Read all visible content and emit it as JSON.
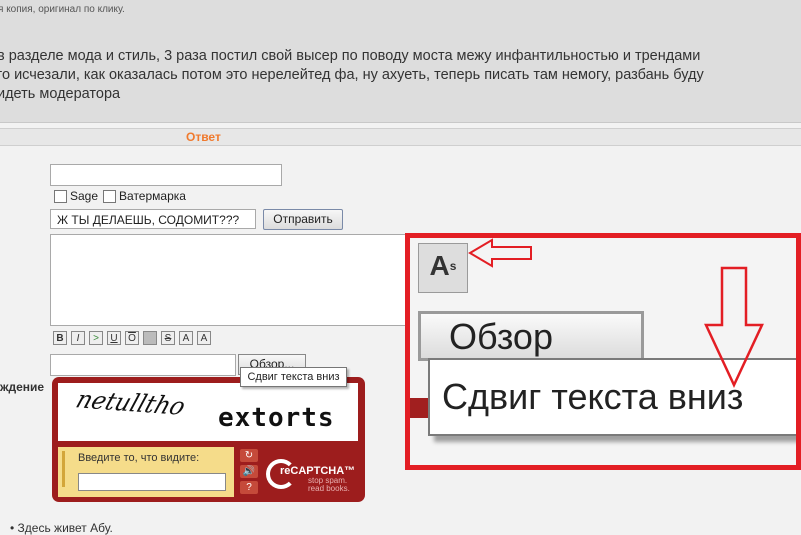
{
  "top_note": "я копия, оригинал по клику.",
  "post_lines": [
    "в разделе мода и стиль, 3 раза постил свой высер по поводу моста межу инфантильностью и трендами",
    "го исчезали, как оказалась потом это нерелейтед фа, ну ахуеть, теперь писать там немогу, разбань буду",
    "идеть модератора"
  ],
  "reply_header": "Ответ",
  "form": {
    "email_value": "",
    "sage_label": "Sage",
    "watermark_label": "Ватермарка",
    "subject_value": "Ж ТЫ ДЕЛАЕШЬ, СОДОМИТ???",
    "send_label": "Отправить",
    "message_value": "",
    "format_buttons": [
      "B",
      "I",
      ">",
      "U",
      "O",
      "",
      "S",
      "A",
      "A"
    ],
    "browse_label": "Обзор...",
    "tooltip": "Сдвиг текста вниз",
    "side_label": "ждение"
  },
  "captcha": {
    "word1": "netulltho",
    "word2": "extorts",
    "prompt": "Введите то, что видите:",
    "input_value": "",
    "controls": [
      "↻",
      "🔊",
      "?"
    ],
    "logo_text": "reCAPTCHA™",
    "tagline": "stop spam. read books."
  },
  "bullet_item": "Здесь живет Абу.",
  "zoom": {
    "icon_text": "A",
    "button_text": "Обзор",
    "tooltip_text": "Сдвиг текста вниз"
  },
  "colors": {
    "annotation_red": "#e31e24",
    "reply_orange": "#f07a2e",
    "captcha_red": "#9d1d1d"
  }
}
